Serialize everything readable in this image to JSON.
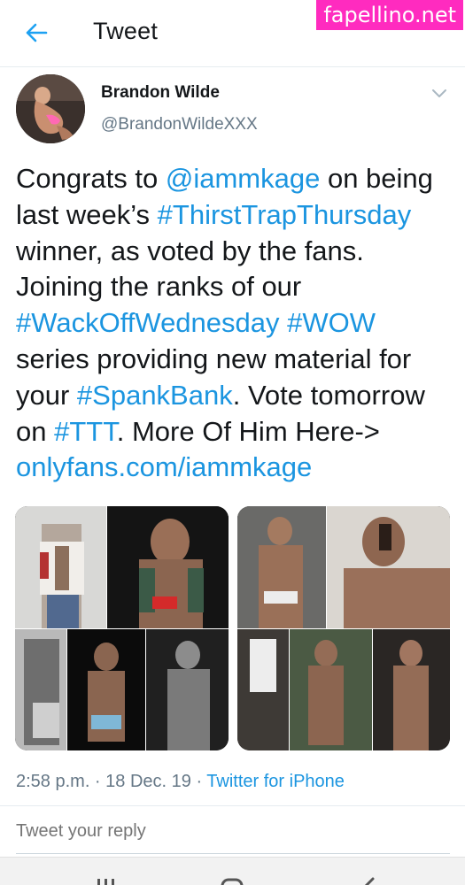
{
  "header": {
    "title": "Tweet",
    "back_icon": "back-arrow-icon"
  },
  "watermark": {
    "text": "fapellino.net"
  },
  "author": {
    "name": "Brandon Wilde",
    "handle": "@BrandonWildeXXX"
  },
  "tweet": {
    "p1": "Congrats to ",
    "mention": "@iammkage",
    "p2": " on being last week’s ",
    "tag1": "#ThirstTrapThursday",
    "p3": " winner, as voted by the fans. Joining the ranks of our ",
    "tag2": "#WackOffWednesday",
    "sp1": " ",
    "tag3": "#WOW",
    "p4": " series providing new material for your ",
    "tag4": "#SpankBank",
    "p5": ". Vote tomorrow on ",
    "tag5": "#TTT",
    "p6": ". More Of Him Here-> ",
    "link": "onlyfans.com/iammkage"
  },
  "meta": {
    "time": "2:58 p.m. · 18 Dec. 19 · ",
    "source": "Twitter for iPhone"
  },
  "reply": {
    "placeholder": "Tweet your reply"
  },
  "colors": {
    "link": "#1b95e0",
    "secondary": "#657786",
    "watermark_bg": "#ff2bbf"
  }
}
